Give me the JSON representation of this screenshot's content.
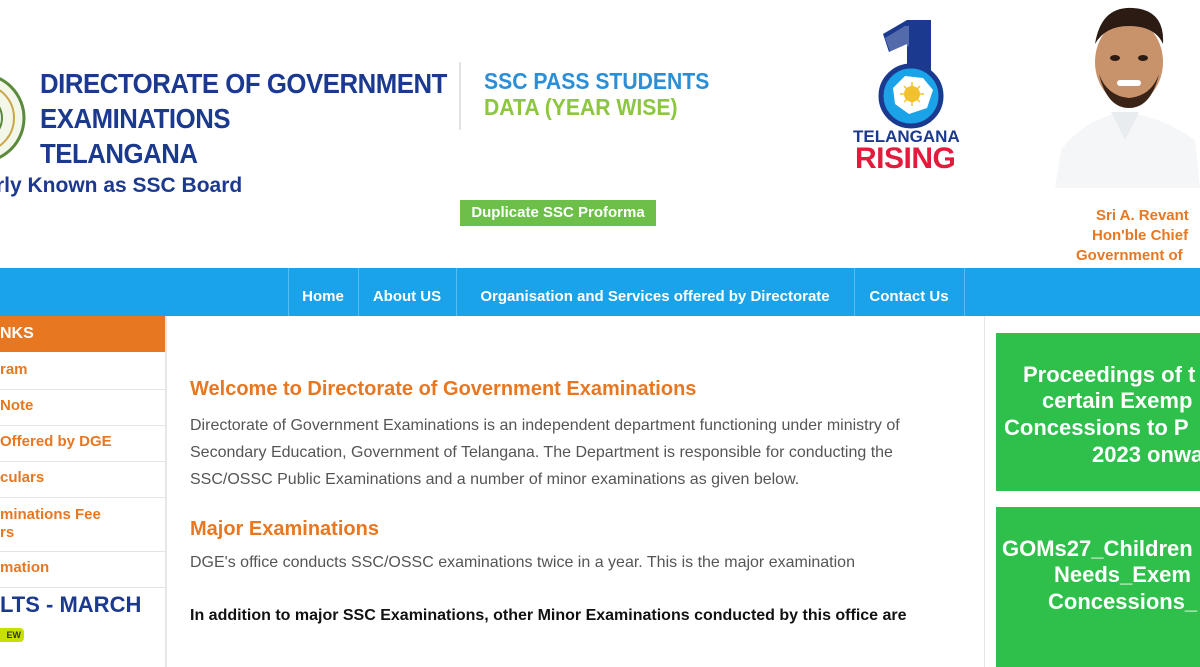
{
  "header": {
    "org_title_line1": "DIRECTORATE OF GOVERNMENT",
    "org_title_line2": "EXAMINATIONS",
    "org_title_line3": "TELANGANA",
    "formerly": "rly Known as SSC Board",
    "ssc_pass_line1": "SSC PASS STUDENTS",
    "ssc_pass_line2": "DATA (YEAR WISE)",
    "duplicate_button": "Duplicate SSC Proforma",
    "rising_line1": "TELANGANA",
    "rising_line2": "RISING",
    "cm_name": "Sri A. Revant",
    "cm_title": "Hon'ble Chief",
    "cm_govt": "Government of"
  },
  "nav": {
    "items": [
      "Home",
      "About US",
      "Organisation and Services offered by Directorate",
      "Contact Us"
    ]
  },
  "sidebar": {
    "heading": "NKS",
    "items": [
      "ram",
      "Note",
      "Offered by DGE",
      "culars",
      "minations Fee",
      "rs",
      "mation"
    ],
    "results_text": "LTS - MARCH",
    "new_badge": "EW"
  },
  "main": {
    "welcome_heading": "Welcome to Directorate of Government Examinations",
    "intro_text": "Directorate of Government Examinations is an independent department functioning under ministry of Secondary Education, Government of Telangana. The Department is responsible for conducting the SSC/OSSC Public Examinations and a number of minor examinations as given below.",
    "major_heading": "Major Examinations",
    "major_text": "DGE's office conducts SSC/OSSC examinations twice in a year. This is the major examination",
    "minor_text": "In addition to major SSC Examinations, other Minor Examinations conducted by this office are"
  },
  "right_panel": {
    "box1_lines": [
      "Proceedings of t",
      "certain Exemp",
      "Concessions to P",
      "2023 onwa"
    ],
    "box2_lines": [
      "GOMs27_Children",
      "Needs_Exem",
      "Concessions_"
    ]
  },
  "colors": {
    "navy": "#1b3a8f",
    "orange": "#e87722",
    "nav_blue": "#1aa3e8",
    "green_button": "#6cc04a",
    "green_panel": "#2ec04a",
    "rising_red": "#e21b3c"
  }
}
